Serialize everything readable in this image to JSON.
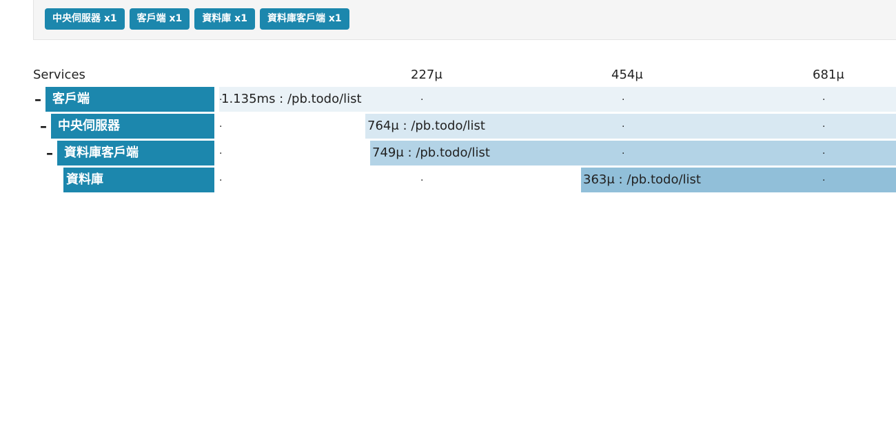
{
  "filters": [
    {
      "label": "中央伺服器 x1"
    },
    {
      "label": "客戶端 x1"
    },
    {
      "label": "資料庫 x1"
    },
    {
      "label": "資料庫客戶端 x1"
    }
  ],
  "timeline": {
    "column_header": "Services",
    "ticks": [
      "227μ",
      "454μ",
      "681μ"
    ]
  },
  "rows": [
    {
      "expander": "–",
      "service": "客戶端",
      "span_label": "1.135ms : /pb.todo/list",
      "span_color": "#eaf2f7"
    },
    {
      "expander": "–",
      "service": "中央伺服器",
      "span_label": "764μ : /pb.todo/list",
      "span_color": "#d8e8f2"
    },
    {
      "expander": "–",
      "service": "資料庫客戶端",
      "span_label": "749μ : /pb.todo/list",
      "span_color": "#b3d3e6"
    },
    {
      "expander": "",
      "service": "資料庫",
      "span_label": "363μ : /pb.todo/list",
      "span_color": "#91bfd9"
    }
  ],
  "tick_marker": "·"
}
